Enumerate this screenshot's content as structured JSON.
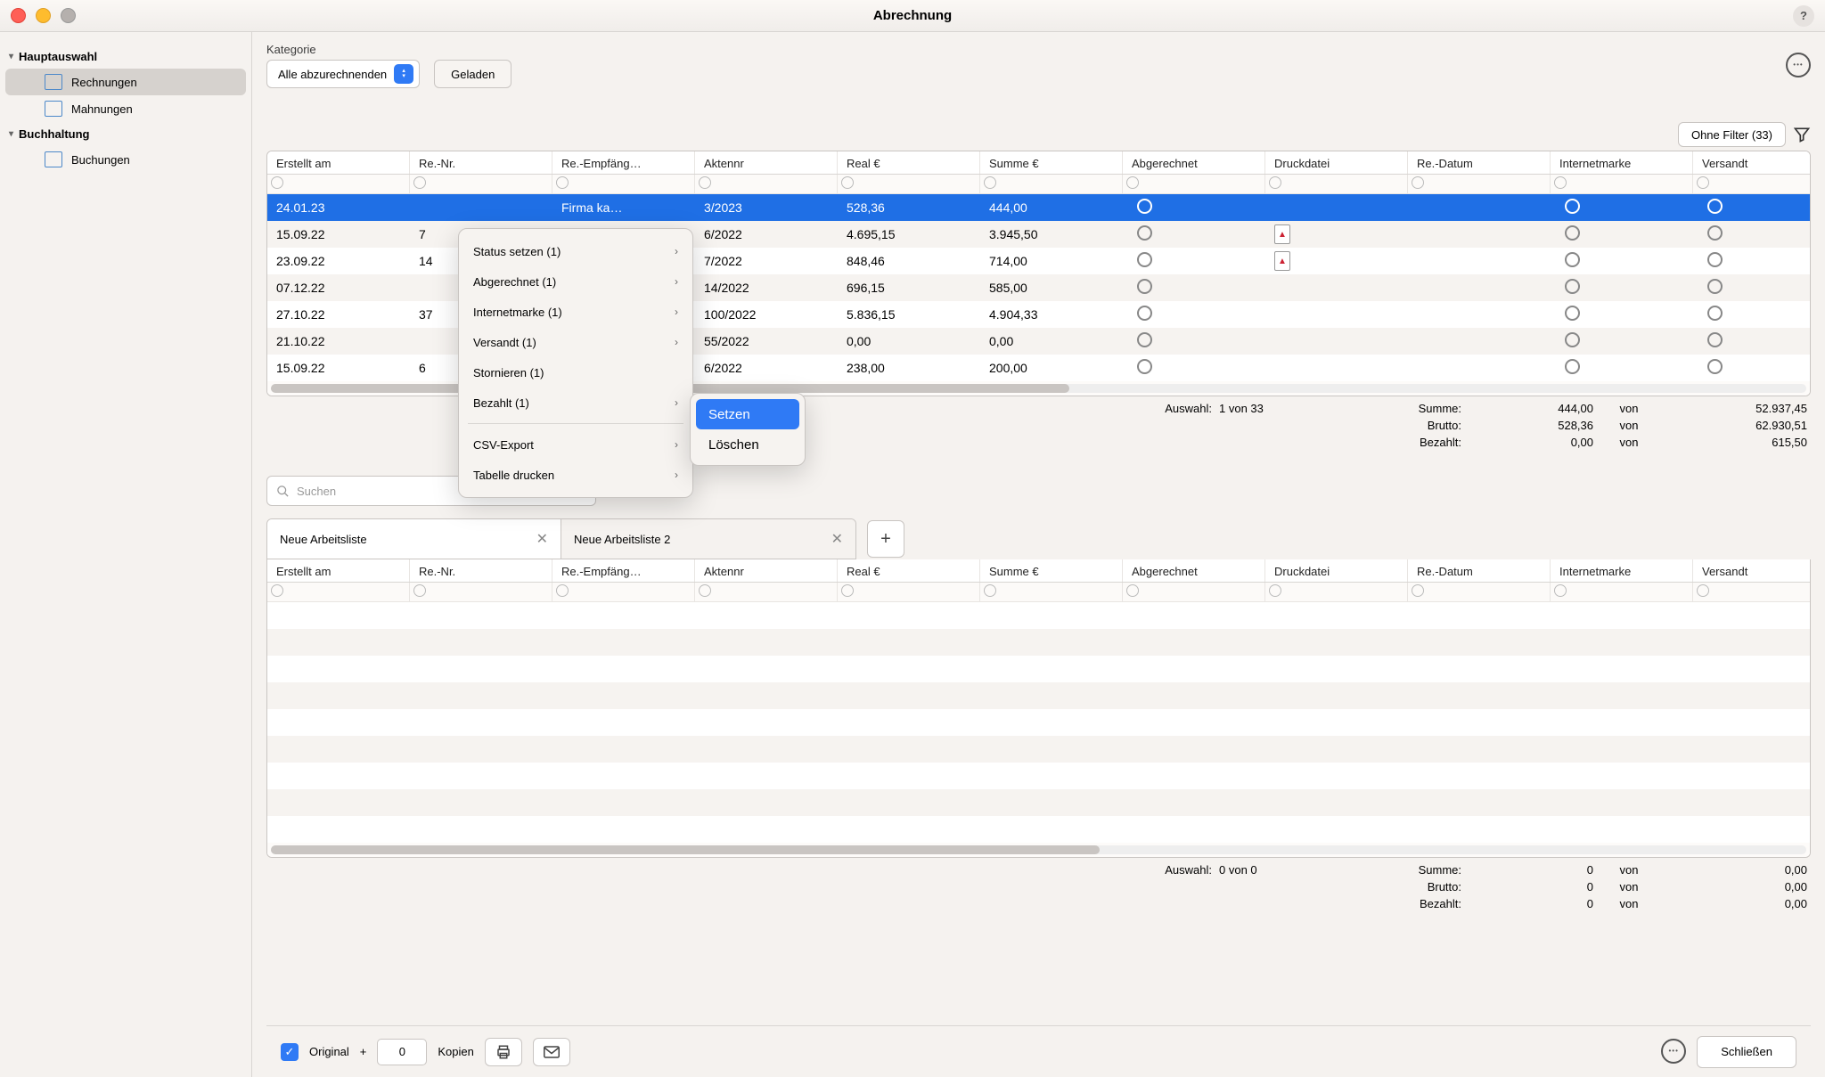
{
  "window": {
    "title": "Abrechnung"
  },
  "sidebar": {
    "groups": [
      {
        "label": "Hauptauswahl",
        "items": [
          {
            "label": "Rechnungen"
          },
          {
            "label": "Mahnungen"
          }
        ]
      },
      {
        "label": "Buchhaltung",
        "items": [
          {
            "label": "Buchungen"
          }
        ]
      }
    ]
  },
  "toolbar": {
    "category_label": "Kategorie",
    "category_value": "Alle abzurechnenden",
    "loaded_label": "Geladen"
  },
  "filter": {
    "label": "Ohne Filter (33)"
  },
  "chart_data": {
    "type": "table",
    "columns": [
      "Erstellt am",
      "Re.-Nr.",
      "Re.-Empfäng…",
      "Aktennr",
      "Real €",
      "Summe €",
      "Abgerechnet",
      "Druckdatei",
      "Re.-Datum",
      "Internetmarke",
      "Versandt"
    ],
    "rows": [
      {
        "erstellt": "24.01.23",
        "renr": "",
        "empf": "Firma ka…",
        "akt": "3/2023",
        "real": "528,36",
        "summe": "444,00",
        "pdf": false
      },
      {
        "erstellt": "15.09.22",
        "renr": "7",
        "empf": "",
        "akt": "6/2022",
        "real": "4.695,15",
        "summe": "3.945,50",
        "pdf": true
      },
      {
        "erstellt": "23.09.22",
        "renr": "14",
        "empf": "",
        "akt": "7/2022",
        "real": "848,46",
        "summe": "714,00",
        "pdf": true
      },
      {
        "erstellt": "07.12.22",
        "renr": "",
        "empf": "",
        "akt": "14/2022",
        "real": "696,15",
        "summe": "585,00",
        "pdf": false
      },
      {
        "erstellt": "27.10.22",
        "renr": "37",
        "empf": "",
        "akt": "100/2022",
        "real": "5.836,15",
        "summe": "4.904,33",
        "pdf": false
      },
      {
        "erstellt": "21.10.22",
        "renr": "",
        "empf": "",
        "akt": "55/2022",
        "real": "0,00",
        "summe": "0,00",
        "pdf": false
      },
      {
        "erstellt": "15.09.22",
        "renr": "6",
        "empf": "",
        "akt": "6/2022",
        "real": "238,00",
        "summe": "200,00",
        "pdf": false
      }
    ]
  },
  "summary_top": {
    "auswahl_label": "Auswahl:",
    "auswahl_value": "1 von 33",
    "rows": [
      {
        "label": "Summe:",
        "v1": "444,00",
        "von": "von",
        "v2": "52.937,45"
      },
      {
        "label": "Brutto:",
        "v1": "528,36",
        "von": "von",
        "v2": "62.930,51"
      },
      {
        "label": "Bezahlt:",
        "v1": "0,00",
        "von": "von",
        "v2": "615,50"
      }
    ]
  },
  "search": {
    "placeholder": "Suchen"
  },
  "tabs": [
    {
      "label": "Neue Arbeitsliste"
    },
    {
      "label": "Neue Arbeitsliste 2"
    }
  ],
  "summary_bottom": {
    "auswahl_label": "Auswahl:",
    "auswahl_value": "0 von 0",
    "rows": [
      {
        "label": "Summe:",
        "v1": "0",
        "von": "von",
        "v2": "0,00"
      },
      {
        "label": "Brutto:",
        "v1": "0",
        "von": "von",
        "v2": "0,00"
      },
      {
        "label": "Bezahlt:",
        "v1": "0",
        "von": "von",
        "v2": "0,00"
      }
    ]
  },
  "footer": {
    "original_label": "Original",
    "plus": "+",
    "copies_value": "0",
    "copies_label": "Kopien",
    "close_label": "Schließen"
  },
  "context_menu": {
    "items": [
      {
        "label": "Status setzen (1)",
        "arrow": true
      },
      {
        "label": "Abgerechnet (1)",
        "arrow": true
      },
      {
        "label": "Internetmarke (1)",
        "arrow": true
      },
      {
        "label": "Versandt (1)",
        "arrow": true
      },
      {
        "label": "Stornieren (1)",
        "arrow": false
      },
      {
        "label": "Bezahlt (1)",
        "arrow": true
      }
    ],
    "items2": [
      {
        "label": "CSV-Export",
        "arrow": true
      },
      {
        "label": "Tabelle drucken",
        "arrow": true
      }
    ],
    "submenu": [
      {
        "label": "Setzen",
        "hot": true
      },
      {
        "label": "Löschen",
        "hot": false
      }
    ]
  }
}
